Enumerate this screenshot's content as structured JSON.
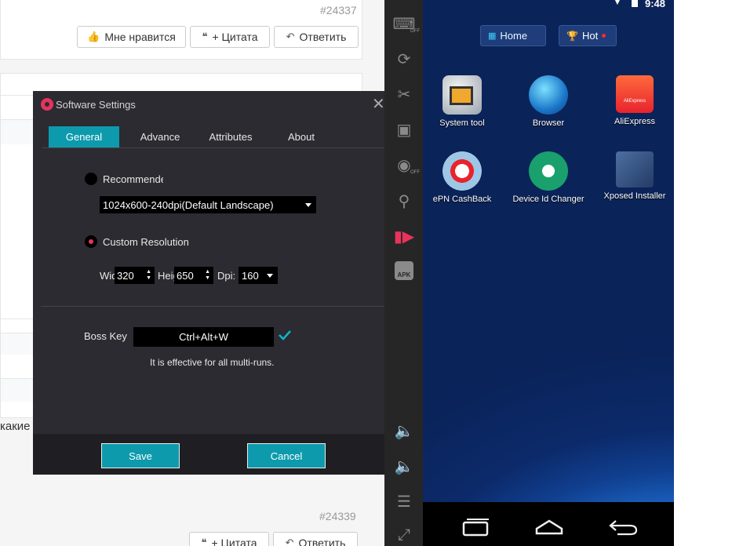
{
  "forum": {
    "post_number_top": "#24337",
    "like_label": "Мне нравится",
    "quote_label": "+ Цитата",
    "reply_label": "Ответить",
    "partial_text": "какие",
    "post_number_bottom": "#24339"
  },
  "dialog": {
    "title": "Software Settings",
    "tabs": [
      {
        "label": "General"
      },
      {
        "label": "Advance"
      },
      {
        "label": "Attributes"
      },
      {
        "label": "About"
      }
    ],
    "recommended_label": "Recommended",
    "resolution_select": "1024x600-240dpi(Default Landscape)",
    "custom_label": "Custom Resolution",
    "width_label": "Width",
    "width_value": "320",
    "height_label": "Height",
    "height_value": "650",
    "dpi_label": "Dpi:",
    "dpi_value": "160",
    "boss_key_label": "Boss Key",
    "boss_key_value": "Ctrl+Alt+W",
    "boss_key_note": "It is effective for all multi-runs.",
    "save_label": "Save",
    "cancel_label": "Cancel"
  },
  "toolbar": {
    "items": [
      "keyboard-icon",
      "rotate-icon",
      "scissors-icon",
      "inbox-icon",
      "camera-icon",
      "location-icon",
      "video-record-icon",
      "apk-install-icon",
      "volume-up-icon",
      "volume-down-icon",
      "menu-icon",
      "fullscreen-icon"
    ],
    "off_label": "OFF",
    "apk_label": "APK"
  },
  "android": {
    "time": "9:48",
    "tabs": {
      "home": "Home",
      "hot": "Hot"
    },
    "apps": [
      {
        "name": "System tool"
      },
      {
        "name": "Browser"
      },
      {
        "name": "AliExpress",
        "badge": "AliExpress"
      },
      {
        "name": "ePN CashBack"
      },
      {
        "name": "Device Id Changer"
      },
      {
        "name": "Xposed Installer"
      }
    ]
  },
  "colors": {
    "accent": "#0d9aad",
    "brand_red": "#e8335d",
    "dialog_bg": "#2b2b31"
  }
}
